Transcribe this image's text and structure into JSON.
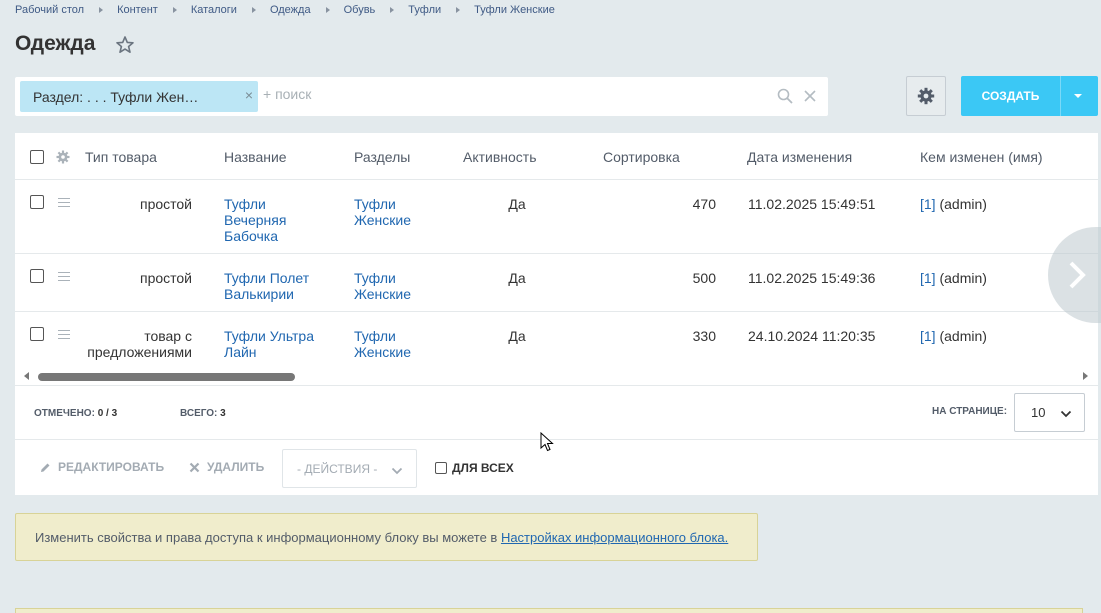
{
  "breadcrumb": [
    "Рабочий стол",
    "Контент",
    "Каталоги",
    "Одежда",
    "Обувь",
    "Туфли",
    "Туфли Женские"
  ],
  "page": {
    "title": "Одежда"
  },
  "filter": {
    "chip_label": "Раздел: . . . Туфли Жен…",
    "chip_close": "×",
    "search_placeholder": "+ поиск"
  },
  "toolbar": {
    "create_label": "СОЗДАТЬ"
  },
  "grid": {
    "columns": [
      "Тип товара",
      "Название",
      "Разделы",
      "Активность",
      "Сортировка",
      "Дата изменения",
      "Кем изменен (имя)"
    ],
    "rows": [
      {
        "type": "простой",
        "name": "Туфли Вечерняя Бабочка",
        "section": "Туфли Женские",
        "active": "Да",
        "sort": "470",
        "date": "11.02.2025 15:49:51",
        "user_id": "[1]",
        "user_name": " (admin)"
      },
      {
        "type": "простой",
        "name": "Туфли Полет Валькирии",
        "section": "Туфли Женские",
        "active": "Да",
        "sort": "500",
        "date": "11.02.2025 15:49:36",
        "user_id": "[1]",
        "user_name": " (admin)"
      },
      {
        "type": "товар с предложениями",
        "name": "Туфли Ультра Лайн",
        "section": "Туфли Женские",
        "active": "Да",
        "sort": "330",
        "date": "24.10.2024 11:20:35",
        "user_id": "[1]",
        "user_name": " (admin)"
      }
    ]
  },
  "footer": {
    "selected_label": "ОТМЕЧЕНО:",
    "selected_value": "0 / 3",
    "total_label": "ВСЕГО:",
    "total_value": "3",
    "page_size_label": "НА СТРАНИЦЕ:",
    "page_size_value": "10"
  },
  "actions": {
    "edit_label": "РЕДАКТИРОВАТЬ",
    "delete_label": "УДАЛИТЬ",
    "select_placeholder": "- ДЕЙСТВИЯ -",
    "for_all_label": "ДЛЯ ВСЕХ"
  },
  "notice": {
    "text": "Изменить свойства и права доступа к информационному блоку вы можете в ",
    "link": "Настройках информационного блока."
  },
  "colors": {
    "accent": "#3bc8f5",
    "link": "#2067b0",
    "notice_bg": "#f0edcc"
  }
}
